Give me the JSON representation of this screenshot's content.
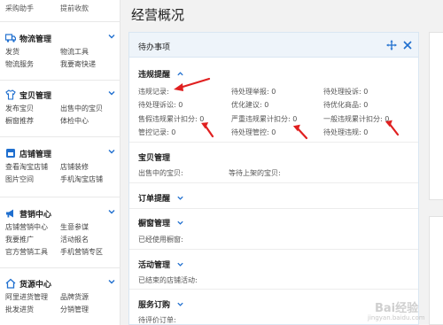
{
  "sidebar": {
    "top_links": [
      "采购助手",
      "提前收款"
    ],
    "sections": [
      {
        "title": "物流管理",
        "icon": "truck-icon",
        "links": [
          "发货",
          "物流工具",
          "物流服务",
          "我要寄快递"
        ]
      },
      {
        "title": "宝贝管理",
        "icon": "shirt-icon",
        "links": [
          "发布宝贝",
          "出售中的宝贝",
          "橱窗推荐",
          "体检中心"
        ]
      },
      {
        "title": "店铺管理",
        "icon": "store-icon",
        "links": [
          "查看淘宝店铺",
          "店铺装修",
          "图片空间",
          "手机淘宝店铺"
        ]
      },
      {
        "title": "营销中心",
        "icon": "megaphone-icon",
        "links": [
          "店铺营销中心",
          "生意参谋",
          "我要推广",
          "活动报名",
          "官方营销工具",
          "手机营销专区"
        ]
      },
      {
        "title": "货源中心",
        "icon": "house-icon",
        "links": [
          "阿里进货管理",
          "品牌货源",
          "批发进货",
          "分销管理"
        ]
      }
    ]
  },
  "main": {
    "title": "经营概况",
    "panel": {
      "title": "待办事项",
      "violation": {
        "title": "违规提醒",
        "items": [
          "违规记录:",
          "待处理举报: 0",
          "待处理投诉: 0",
          "待处理诉讼: 0",
          "优化建议: 0",
          "待优化商品: 0",
          "售假违规累计扣分: 0",
          "严重违规累计扣分: 0",
          "一般违规累计扣分: 0",
          "管控记录: 0",
          "待处理管控: 0",
          "待处理违规: 0"
        ]
      },
      "goods": {
        "title": "宝贝管理",
        "items": [
          "出售中的宝贝:",
          "等待上架的宝贝:"
        ]
      },
      "orders": {
        "title": "订单提醒"
      },
      "showcase": {
        "title": "橱窗管理",
        "items": [
          "已经使用橱窗:"
        ]
      },
      "activity": {
        "title": "活动管理",
        "items": [
          "已结束的店铺活动:"
        ]
      },
      "service": {
        "title": "服务订购",
        "items": [
          "待评价订单:"
        ]
      }
    }
  },
  "watermark": {
    "line1": "Bai经验",
    "line2": "jingyan.baidu.com"
  },
  "colors": {
    "accent": "#1f6fcf",
    "arrow": "#e02020",
    "panel_head": "#eef4fa"
  }
}
